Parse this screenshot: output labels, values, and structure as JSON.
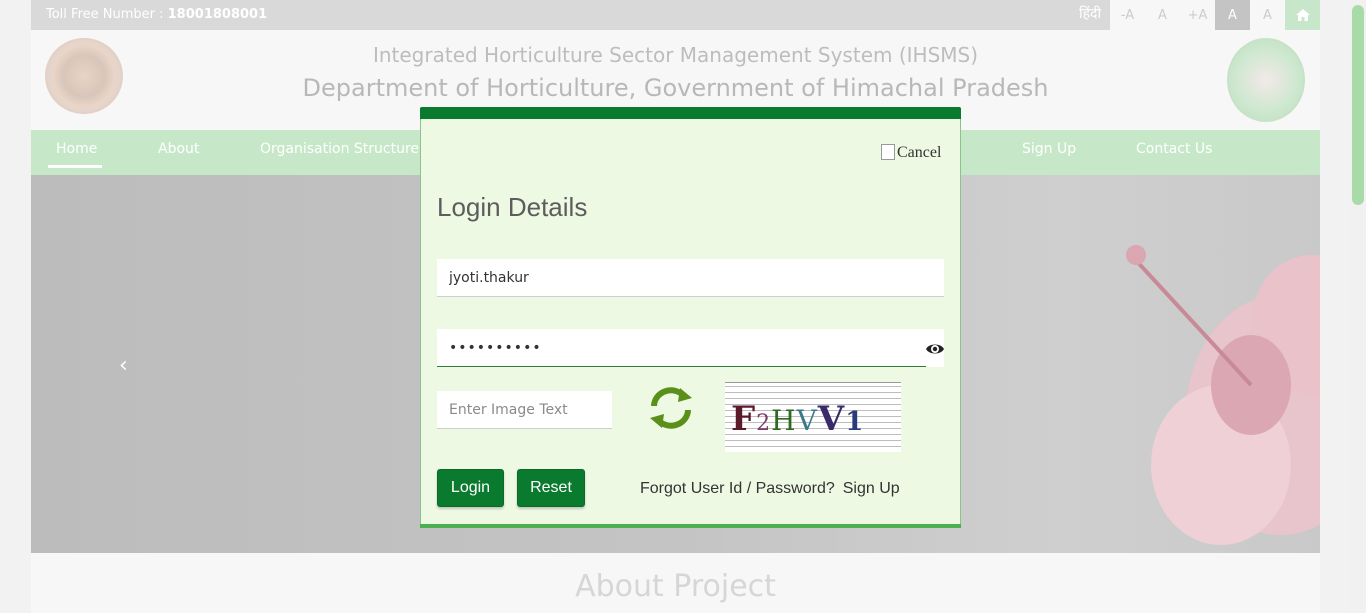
{
  "topbar": {
    "toll_free_label": "Toll Free Number :",
    "toll_free_number": "18001808001",
    "language_link": "हिंदी",
    "font_buttons": [
      "-A",
      "A",
      "+A",
      "A",
      "A"
    ]
  },
  "header": {
    "system_title": "Integrated Horticulture Sector Management System (IHSMS)",
    "department_title": "Department of Horticulture, Government of Himachal Pradesh"
  },
  "nav": {
    "items": [
      {
        "label": "Home"
      },
      {
        "label": "About"
      },
      {
        "label": "Organisation Structure"
      },
      {
        "label": "Sign Up"
      },
      {
        "label": "Contact Us"
      }
    ]
  },
  "banner": {
    "prev_arrow": "‹"
  },
  "about": {
    "heading": "About Project"
  },
  "modal": {
    "cancel_alt": "Cancel",
    "title": "Login Details",
    "username_value": "jyoti.thakur",
    "password_value": "••••••••••",
    "captcha_placeholder": "Enter Image Text",
    "captcha_text": "F2HVV1",
    "login_label": "Login",
    "reset_label": "Reset",
    "forgot_label": "Forgot User Id / Password?",
    "signup_label": "Sign Up"
  },
  "colors": {
    "primary_green": "#0a7a2e",
    "modal_bg": "#eef9e4",
    "nav_bg": "#c7e8c8"
  }
}
